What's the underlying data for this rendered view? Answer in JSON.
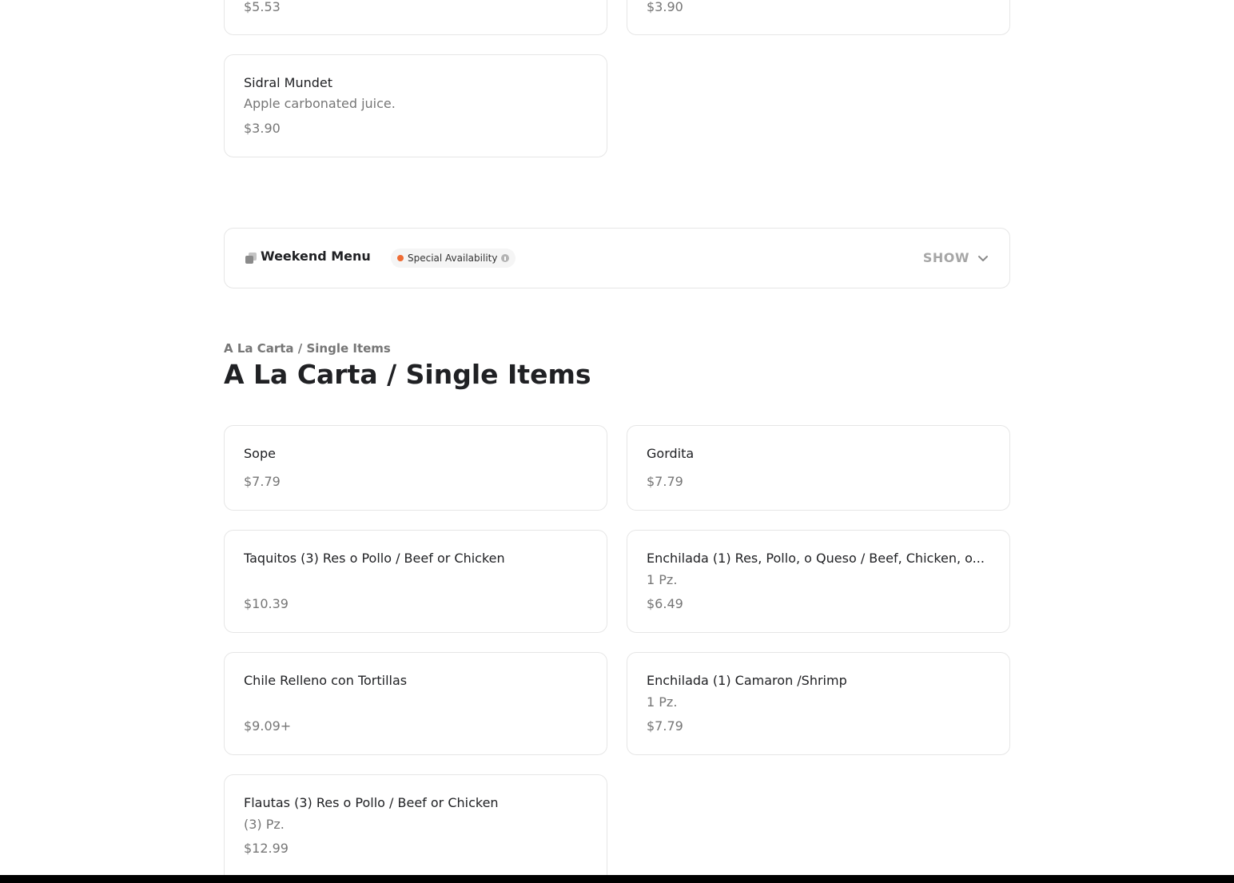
{
  "top_cards": [
    {
      "price": "$5.53"
    },
    {
      "price": "$3.90"
    }
  ],
  "sidral": {
    "name": "Sidral Mundet",
    "description": "Apple carbonated juice.",
    "price": "$3.90"
  },
  "weekend_menu": {
    "title": "Weekend Menu",
    "badge": "Special Availability",
    "toggle": "SHOW",
    "badge_dot_color": "#ef6c34"
  },
  "section": {
    "eyebrow": "A La Carta / Single Items",
    "title": "A La Carta / Single Items",
    "items": [
      {
        "name": "Sope",
        "description": "",
        "price": "$7.79"
      },
      {
        "name": "Gordita",
        "description": "",
        "price": "$7.79"
      },
      {
        "name": "Taquitos (3) Res o Pollo / Beef or Chicken",
        "description": "",
        "price": "$10.39"
      },
      {
        "name": "Enchilada (1) Res, Pollo, o Queso / Beef, Chicken, o...",
        "description": "1 Pz.",
        "price": "$6.49"
      },
      {
        "name": "Chile Relleno con Tortillas",
        "description": "",
        "price": "$9.09+"
      },
      {
        "name": "Enchilada (1) Camaron /Shrimp",
        "description": "1 Pz.",
        "price": "$7.79"
      },
      {
        "name": "Flautas (3) Res o Pollo / Beef or Chicken",
        "description": "(3) Pz.",
        "price": "$12.99"
      }
    ]
  }
}
